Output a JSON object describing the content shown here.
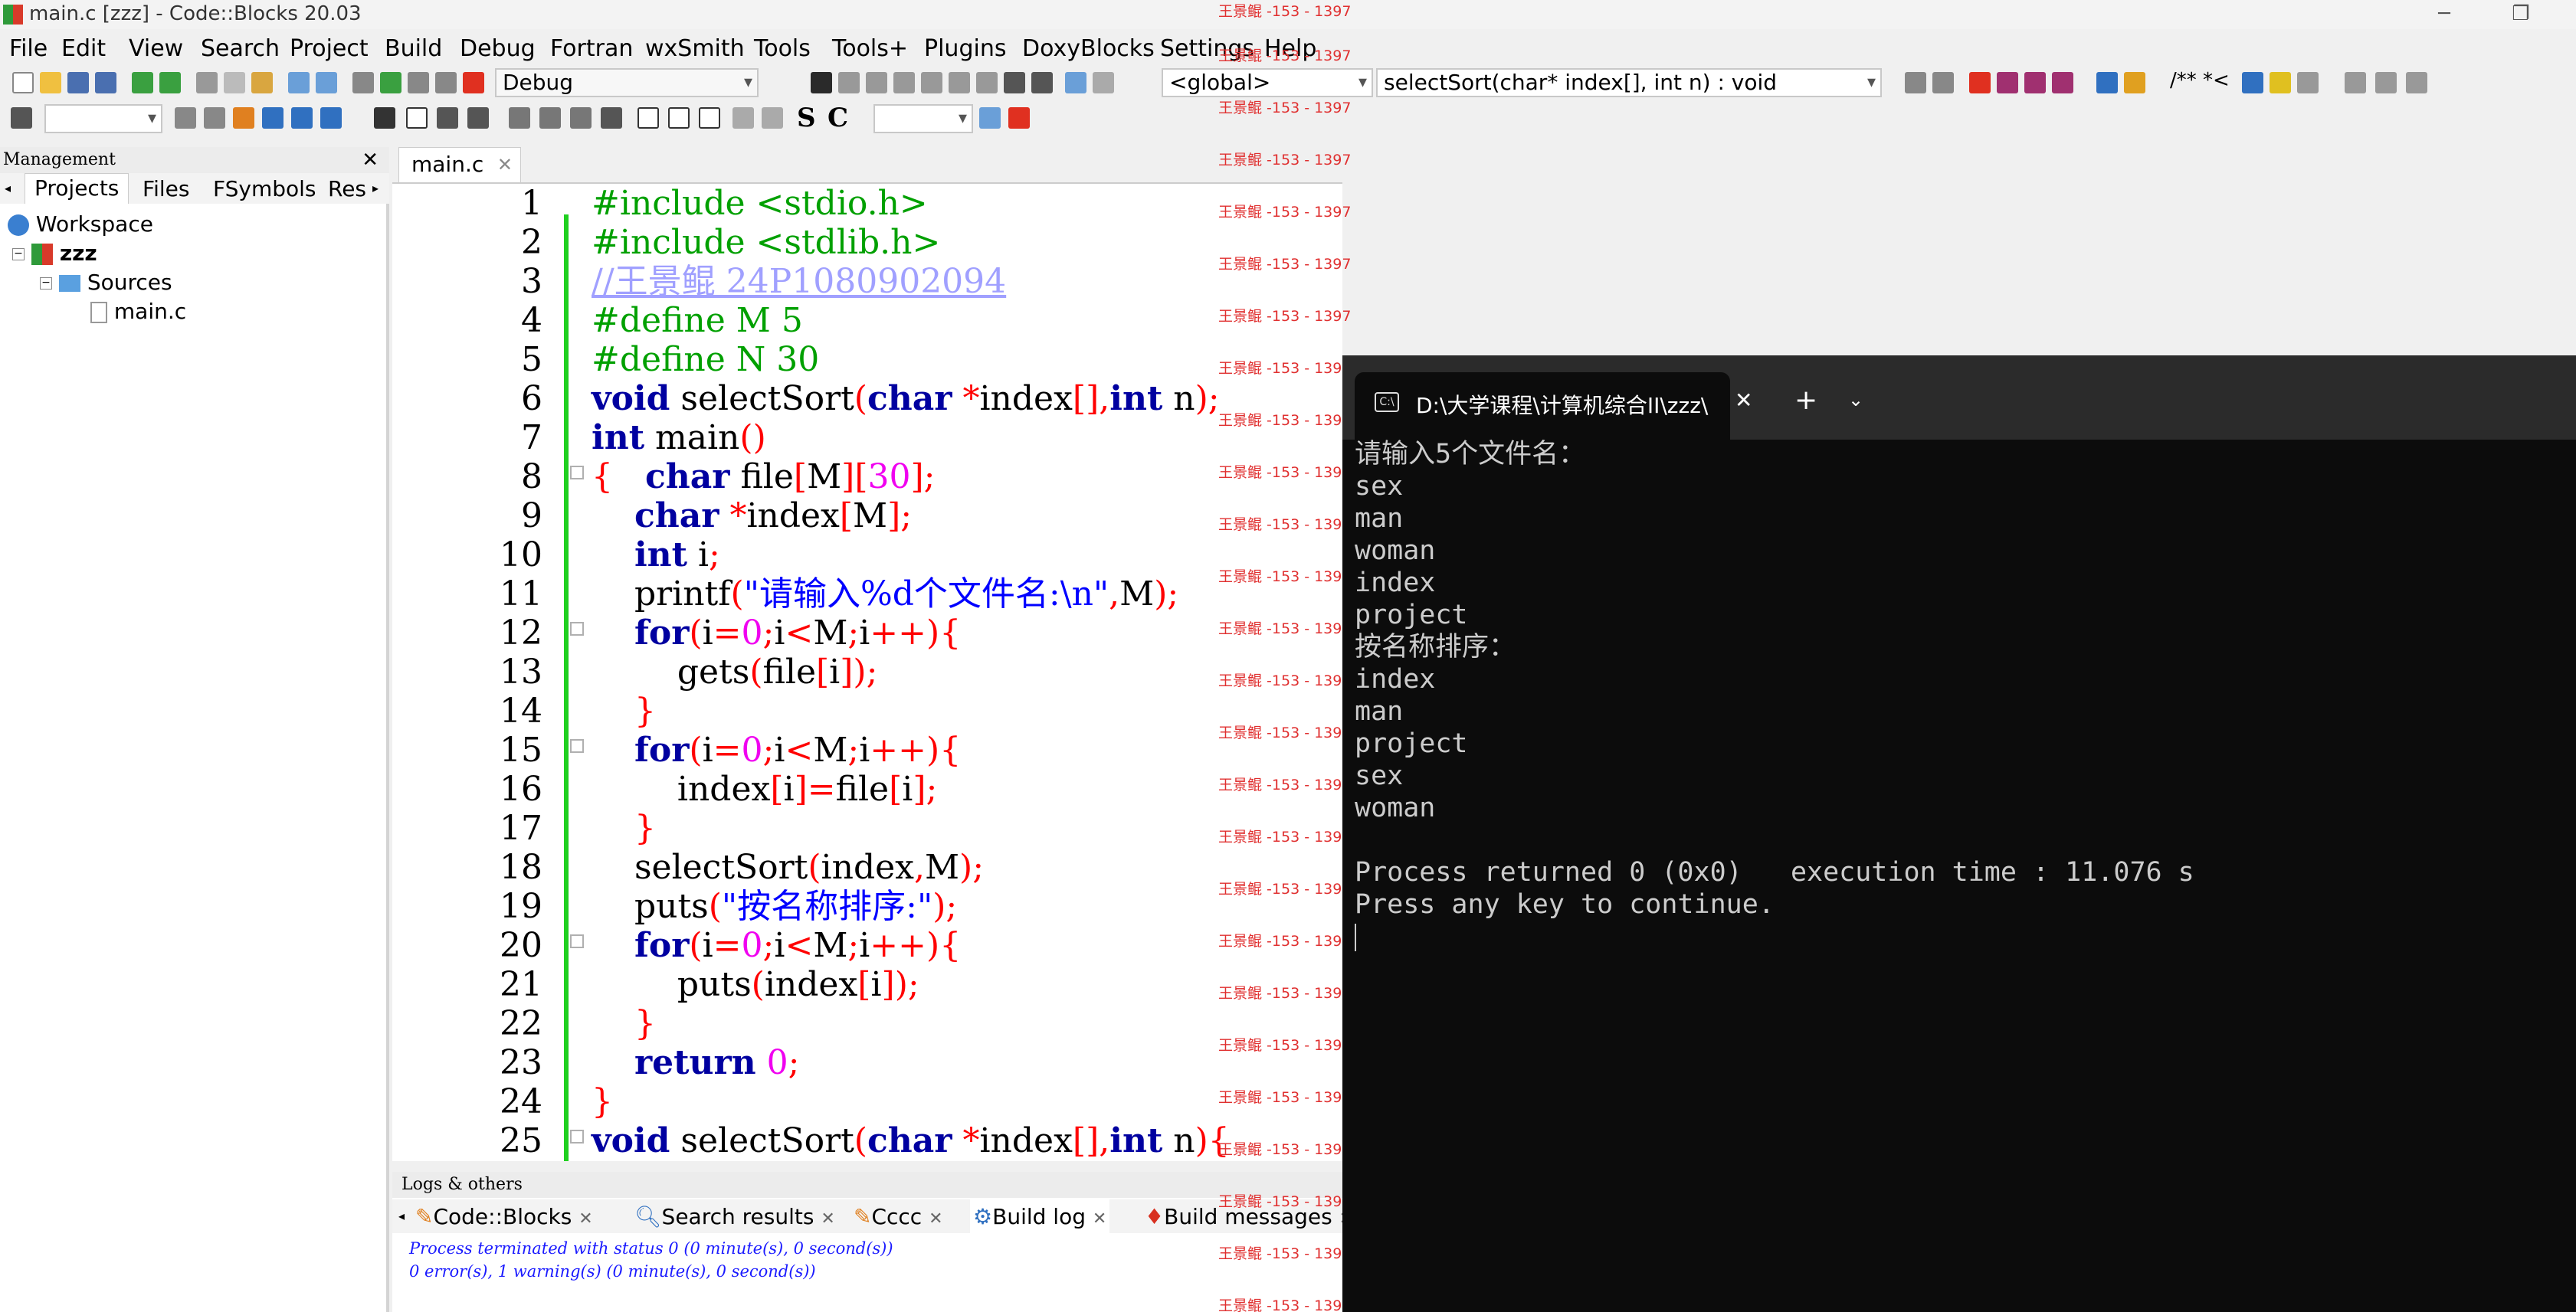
{
  "window": {
    "title": "main.c [zzz] - Code::Blocks 20.03"
  },
  "menu": [
    "File",
    "Edit",
    "View",
    "Search",
    "Project",
    "Build",
    "Debug",
    "Fortran",
    "wxSmith",
    "Tools",
    "Tools+",
    "Plugins",
    "DoxyBlocks",
    "Settings",
    "Help"
  ],
  "toolbar": {
    "build_target": "Debug",
    "scope": "<global>",
    "function": "selectSort(char* index[], int n) : void",
    "doxy_comment": "/** *<"
  },
  "management": {
    "title": "Management",
    "tabs": [
      "Projects",
      "Files",
      "FSymbols",
      "Res"
    ],
    "tree": {
      "workspace": "Workspace",
      "project": "zzz",
      "folder": "Sources",
      "file": "main.c"
    }
  },
  "editor": {
    "tab": "main.c",
    "line_numbers": [
      "1",
      "2",
      "3",
      "4",
      "5",
      "6",
      "7",
      "8",
      "9",
      "10",
      "11",
      "12",
      "13",
      "14",
      "15",
      "16",
      "17",
      "18",
      "19",
      "20",
      "21",
      "22",
      "23",
      "24",
      "25"
    ],
    "lines": [
      "#include <stdio.h>",
      "#include <stdlib.h>",
      "//王景鲲 24P1080902094",
      "#define M 5",
      "#define N 30",
      "void selectSort(char *index[],int n);",
      "int main()",
      "{   char file[M][30];",
      "    char *index[M];",
      "    int i;",
      "    printf(\"请输入%d个文件名:\\n\",M);",
      "    for(i=0;i<M;i++){",
      "        gets(file[i]);",
      "    }",
      "    for(i=0;i<M;i++){",
      "        index[i]=file[i];",
      "    }",
      "    selectSort(index,M);",
      "    puts(\"按名称排序:\");",
      "    for(i=0;i<M;i++){",
      "        puts(index[i]);",
      "    }",
      "    return 0;",
      "}",
      "void selectSort(char *index[],int n){"
    ]
  },
  "logs": {
    "title": "Logs & others",
    "tabs": [
      "Code::Blocks",
      "Search results",
      "Cccc",
      "Build log",
      "Build messages"
    ],
    "messages": [
      "Process terminated with status 0 (0 minute(s), 0 second(s))",
      "0 error(s), 1 warning(s) (0 minute(s), 0 second(s))"
    ]
  },
  "watermark": "王景鲲 -153 - 1397",
  "terminal": {
    "tab_title": "D:\\大学课程\\计算机综合II\\zzz\\",
    "output": [
      "请输入5个文件名：",
      "sex",
      "man",
      "woman",
      "index",
      "project",
      "按名称排序：",
      "index",
      "man",
      "project",
      "sex",
      "woman",
      "",
      "Process returned 0 (0x0)   execution time : 11.076 s",
      "Press any key to continue."
    ]
  },
  "colors": {
    "keyword": "#0000a0",
    "preprocessor": "#00a000",
    "comment": "#a0a0ff",
    "number": "#f000f0",
    "string": "#0000ff",
    "operator": "#ff0000",
    "change_bar": "#20d020",
    "terminal_bg": "#0c0c0c"
  }
}
